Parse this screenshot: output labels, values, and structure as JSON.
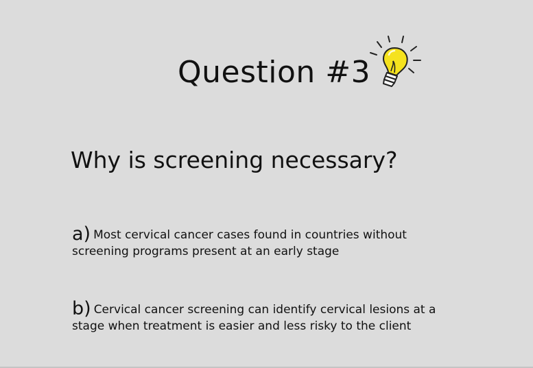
{
  "slide": {
    "title": "Question #3",
    "question": "Why is screening necessary?",
    "answers": [
      {
        "letter": "a)",
        "text": "Most cervical cancer cases found in countries without screening programs present at an early stage"
      },
      {
        "letter": "b)",
        "text": "Cervical cancer screening can identify cervical lesions at a stage when treatment is easier and less risky to the client"
      }
    ],
    "icon": "lightbulb-icon",
    "colors": {
      "background": "#dcdcdc",
      "bulb_fill": "#f5e21e",
      "text": "#111111"
    }
  }
}
